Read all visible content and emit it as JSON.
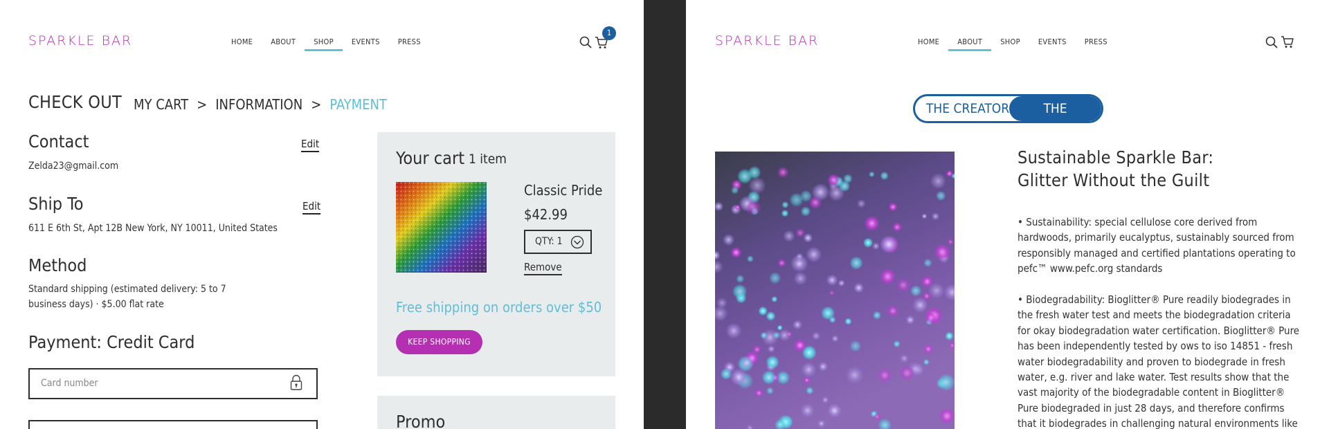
{
  "left": {
    "logo": "SPARKLE BAR",
    "nav": [
      "HOME",
      "ABOUT",
      "SHOP",
      "EVENTS",
      "PRESS"
    ],
    "active_nav": "SHOP",
    "cart_badge": "1",
    "checkout_title": "CHECK OUT",
    "breadcrumb": {
      "step1": "MY CART",
      "step2": "INFORMATION",
      "step3": "PAYMENT",
      "separator": ">"
    },
    "contact": {
      "title": "Contact",
      "value": "Zelda23@gmail.com",
      "edit": "Edit"
    },
    "ship_to": {
      "title": "Ship To",
      "value": "611 E 6th St, Apt 12B New York, NY 10011, United States",
      "edit": "Edit"
    },
    "method": {
      "title": "Method",
      "value": "Standard shipping (estimated delivery: 5 to 7 business days) · $5.00 flat rate"
    },
    "payment": {
      "title": "Payment: Credit Card",
      "card_placeholder": "Card number"
    },
    "cart": {
      "title": "Your cart",
      "count": "1 item",
      "product_name": "Classic Pride",
      "product_price": "$42.99",
      "qty": "QTY: 1",
      "remove": "Remove",
      "free_shipping": "Free shipping on orders over $50",
      "keep_shopping": "KEEP SHOPPING"
    },
    "promo": {
      "title": "Promo"
    }
  },
  "right": {
    "logo": "SPARKLE BAR",
    "nav": [
      "HOME",
      "ABOUT",
      "SHOP",
      "EVENTS",
      "PRESS"
    ],
    "active_nav": "ABOUT",
    "toggle": {
      "option_a": "THE CREATOR",
      "option_b": "THE PRODUCTS",
      "selected": "THE PRODUCTS"
    },
    "title_line1": "Sustainable Sparkle Bar:",
    "title_line2": "Glitter Without the Guilt",
    "para1": "• Sustainability: special cellulose core derived from hardwoods, primarily eucalyptus, sustainably sourced from responsibly managed and certified plantations operating to pefc™ www.pefc.org standards",
    "para2": "• Biodegradability: Bioglitter® Pure readily biodegrades in the fresh water test and meets the biodegradation criteria for okay biodegradation water certification. Bioglitter® Pure has been independently tested by ows to iso 14851 - fresh water biodegradability and proven to biodegrade in fresh water, e.g. river and lake water. Test results show that the vast majority of the biodegradable content in Bioglitter® Pure biodegraded in just 28 days, and therefore confirms that it biodegrades in challenging natural environments like rivers and lakes"
  },
  "colors": {
    "brand_magenta": "#b42fb2",
    "accent_cyan": "#5fc3d8",
    "brand_blue": "#1b5fa0",
    "cart_bg": "#e8eced",
    "divider": "#2b2b2b"
  },
  "icons": [
    "search-icon",
    "cart-icon",
    "lock-icon",
    "chevron-down-icon"
  ]
}
